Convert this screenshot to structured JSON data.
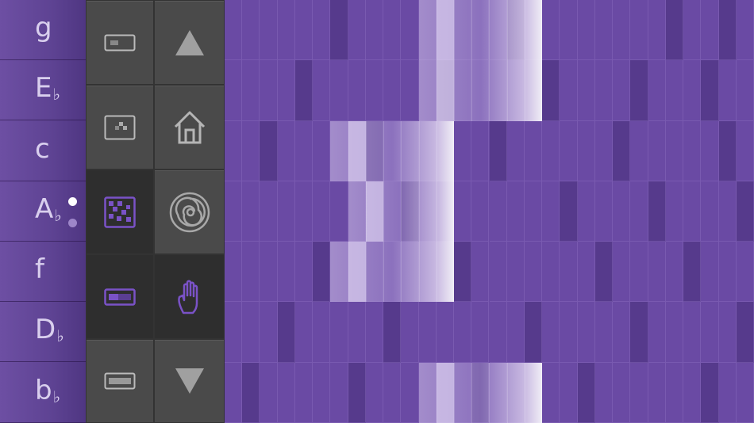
{
  "note_labels": [
    {
      "letter": "g",
      "accidental": ""
    },
    {
      "letter": "E",
      "accidental": "♭"
    },
    {
      "letter": "c",
      "accidental": ""
    },
    {
      "letter": "A",
      "accidental": "♭"
    },
    {
      "letter": "f",
      "accidental": ""
    },
    {
      "letter": "D",
      "accidental": "♭"
    },
    {
      "letter": "b",
      "accidental": "♭"
    }
  ],
  "toolbar": {
    "left_column": [
      {
        "name": "small-block-icon",
        "active": false
      },
      {
        "name": "dotted-block-icon",
        "active": false
      },
      {
        "name": "grid-pattern-icon",
        "active": true
      },
      {
        "name": "slider-block-icon",
        "active": true
      },
      {
        "name": "wide-block-icon",
        "active": false
      }
    ],
    "right_column": [
      {
        "name": "arrow-up-icon",
        "active": false
      },
      {
        "name": "home-icon",
        "active": false
      },
      {
        "name": "spiral-icon",
        "active": false
      },
      {
        "name": "hand-icon",
        "active": true
      },
      {
        "name": "arrow-down-icon",
        "active": false
      }
    ]
  },
  "colors": {
    "grid_base": "#6a4aa4",
    "grid_dark": "#563a8c",
    "accent_purple": "#7a52c7",
    "toolbar_button": "#4a4a4a"
  },
  "grid": {
    "columns": 30,
    "rows": 7,
    "dark_columns": [
      [
        6,
        16,
        25,
        28
      ],
      [
        4,
        12,
        18,
        23,
        27
      ],
      [
        2,
        8,
        15,
        22,
        28
      ],
      [
        10,
        19,
        24,
        29
      ],
      [
        5,
        13,
        21,
        26
      ],
      [
        3,
        9,
        17,
        23,
        29
      ],
      [
        1,
        7,
        14,
        20,
        27
      ]
    ],
    "highlight_blocks": [
      {
        "row": 0,
        "start": 11,
        "length": 7
      },
      {
        "row": 1,
        "start": 11,
        "length": 7
      },
      {
        "row": 2,
        "start": 6,
        "length": 7
      },
      {
        "row": 3,
        "start": 7,
        "length": 6
      },
      {
        "row": 4,
        "start": 6,
        "length": 7
      },
      {
        "row": 6,
        "start": 11,
        "length": 7
      }
    ]
  }
}
